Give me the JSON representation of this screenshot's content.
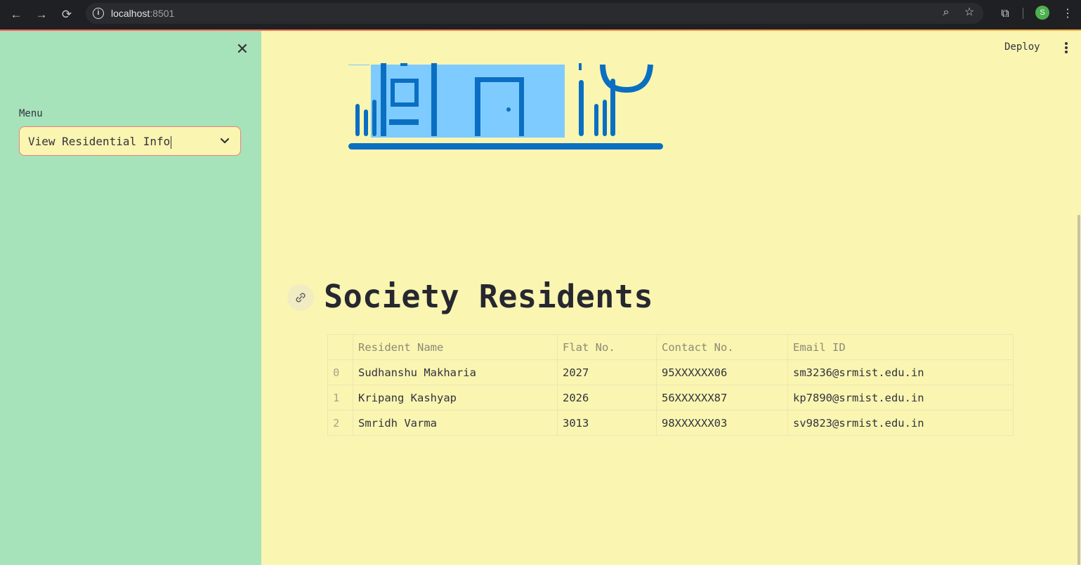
{
  "browser": {
    "url_host": "localhost",
    "url_port": ":8501",
    "profile_initial": "S"
  },
  "sidebar": {
    "menu_label": "Menu",
    "select_value": "View Residential Info"
  },
  "header": {
    "deploy_label": "Deploy"
  },
  "main": {
    "title": "Society Residents",
    "table": {
      "columns": [
        "",
        "Resident Name",
        "Flat No.",
        "Contact No.",
        "Email ID"
      ],
      "rows": [
        [
          "0",
          "Sudhanshu Makharia",
          "2027",
          "95XXXXXX06",
          "sm3236@srmist.edu.in"
        ],
        [
          "1",
          "Kripang Kashyap",
          "2026",
          "56XXXXXX87",
          "kp7890@srmist.edu.in"
        ],
        [
          "2",
          "Smridh Varma",
          "3013",
          "98XXXXXX03",
          "sv9823@srmist.edu.in"
        ]
      ]
    }
  },
  "colors": {
    "sidebar_bg": "#a6e2ba",
    "main_bg": "#faf5b0",
    "select_border": "#f08080",
    "illustration_blue": "#0a6fc2",
    "illustration_light": "#7ecbff"
  },
  "icons": [
    "back-icon",
    "forward-icon",
    "reload-icon",
    "info-icon",
    "zoom-icon",
    "star-icon",
    "extensions-icon",
    "kebab-menu-icon",
    "close-icon",
    "chevron-down-icon",
    "link-icon"
  ]
}
